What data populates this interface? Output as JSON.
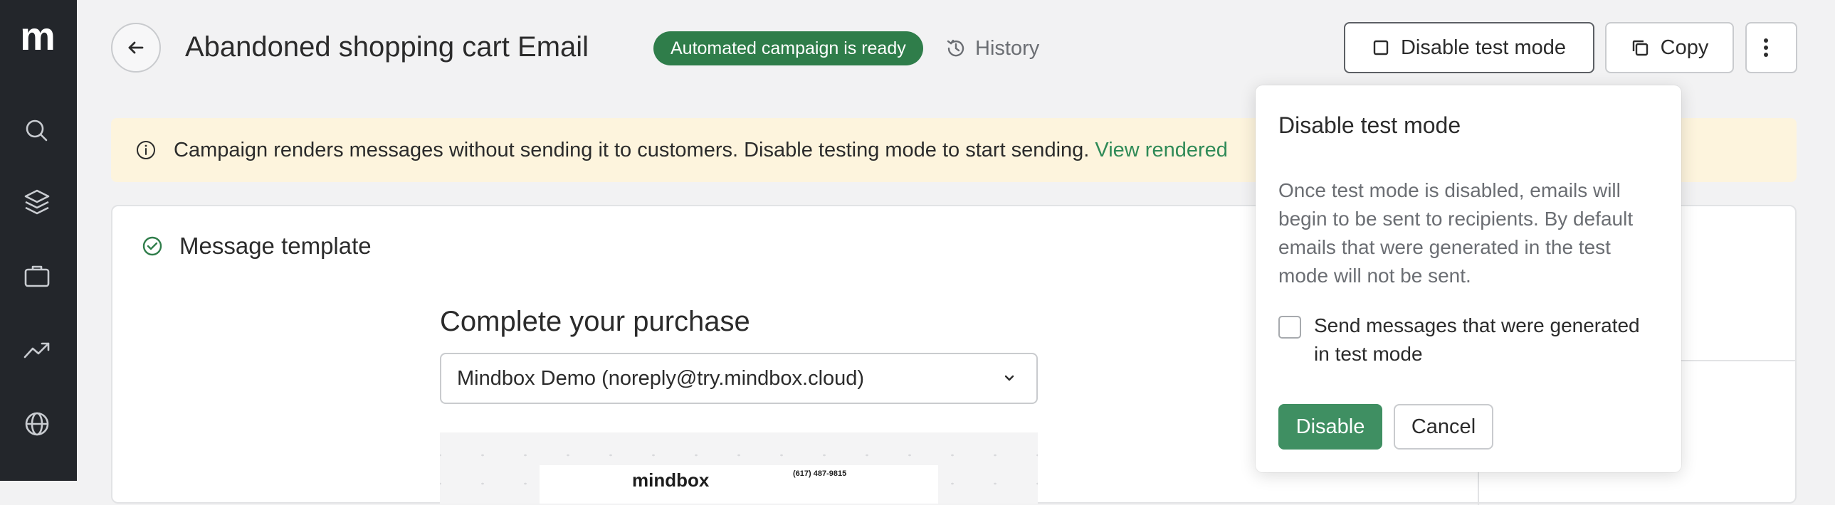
{
  "sidebar": {
    "logo": "m",
    "items": [
      {
        "icon": "search-icon"
      },
      {
        "icon": "layers-icon"
      },
      {
        "icon": "briefcase-icon"
      },
      {
        "icon": "trend-up-icon"
      },
      {
        "icon": "globe-icon"
      }
    ]
  },
  "header": {
    "back_icon": "arrow-left-icon",
    "title": "Abandoned shopping cart Email",
    "status_badge": "Automated campaign is ready",
    "history_label": "History",
    "disable_test_label": "Disable test mode",
    "copy_label": "Copy",
    "more_icon": "more-vertical-icon"
  },
  "banner": {
    "text": "Campaign renders messages without sending it to customers. Disable testing mode to start sending.",
    "link": "View rendered"
  },
  "template_card": {
    "title": "Message template",
    "subject": "Complete your purchase",
    "sender": "Mindbox Demo (noreply@try.mindbox.cloud)",
    "preview_brand": "mindbox",
    "preview_phone": "(617) 487-9815"
  },
  "popover": {
    "title": "Disable test mode",
    "description": "Once test mode is disabled, emails will begin to be sent to recipients. By default emails that were generated in the test mode will not be sent.",
    "checkbox_label": "Send messages that were generated in test mode",
    "checkbox_checked": false,
    "disable_label": "Disable",
    "cancel_label": "Cancel"
  },
  "colors": {
    "sidebar_bg": "#23262b",
    "accent_green": "#2f7d4a",
    "button_green": "#3f8f62",
    "banner_bg": "#fdf4dd",
    "link_green": "#2f8a57"
  }
}
